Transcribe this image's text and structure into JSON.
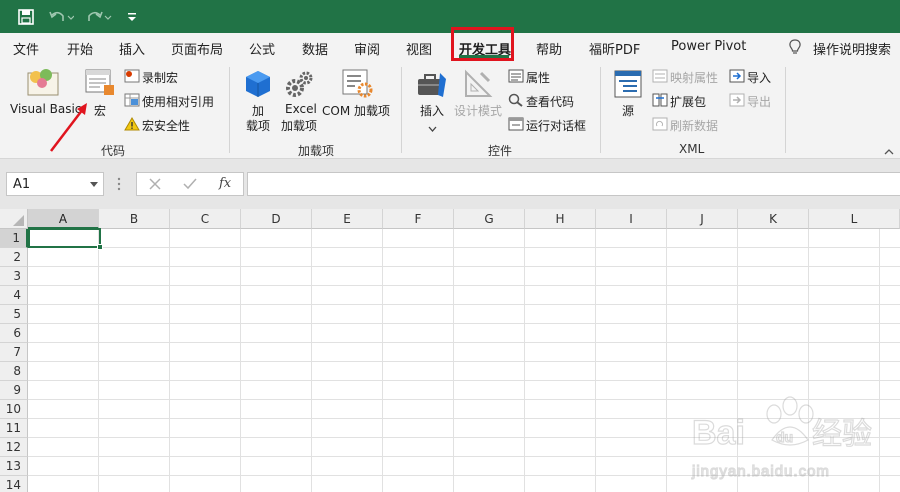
{
  "tabs": {
    "file": "文件",
    "home": "开始",
    "insert": "插入",
    "page_layout": "页面布局",
    "formulas": "公式",
    "data": "数据",
    "review": "审阅",
    "view": "视图",
    "developer": "开发工具",
    "help": "帮助",
    "foxit_pdf": "福昕PDF",
    "power_pivot": "Power Pivot",
    "tell_me": "操作说明搜索"
  },
  "ribbon": {
    "code": {
      "visual_basic": "Visual Basic",
      "macros": "宏",
      "record_macro": "录制宏",
      "use_relative_refs": "使用相对引用",
      "macro_security": "宏安全性",
      "label": "代码"
    },
    "addins": {
      "addins_1": "加",
      "addins_2": "载项",
      "excel_1": "Excel",
      "excel_2": "加载项",
      "com": "COM 加载项",
      "label": "加载项"
    },
    "controls": {
      "insert": "插入",
      "design_mode": "设计模式",
      "properties": "属性",
      "view_code": "查看代码",
      "run_dialog": "运行对话框",
      "label": "控件"
    },
    "xml": {
      "source": "源",
      "map_properties": "映射属性",
      "expansion_packs": "扩展包",
      "refresh_data": "刷新数据",
      "import": "导入",
      "export": "导出",
      "label": "XML"
    }
  },
  "formula_bar": {
    "name_box": "A1",
    "fx": "fx",
    "formula": ""
  },
  "grid": {
    "columns": [
      "A",
      "B",
      "C",
      "D",
      "E",
      "F",
      "G",
      "H",
      "I",
      "J",
      "K",
      "L"
    ],
    "rows": [
      "1",
      "2",
      "3",
      "4",
      "5",
      "6",
      "7",
      "8",
      "9",
      "10",
      "11",
      "12",
      "13",
      "14"
    ],
    "active_cell": "A1"
  },
  "colors": {
    "excel_green": "#217346",
    "annotation_red": "#e0141e"
  },
  "watermark": {
    "brand": "Bai",
    "brand2": "du",
    "cn": "经验",
    "url": "jingyan.baidu.com"
  }
}
